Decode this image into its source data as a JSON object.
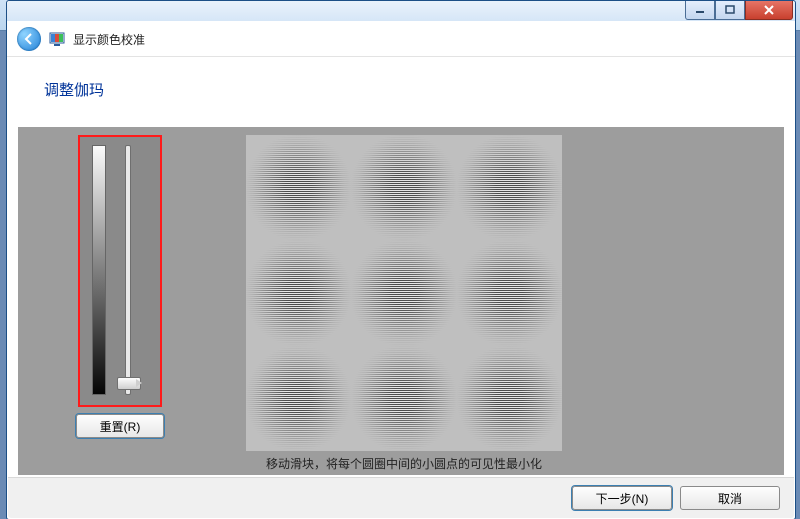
{
  "window": {
    "app_title": "显示颜色校准",
    "min_tip": "Minimize",
    "max_tip": "Maximize",
    "close_tip": "Close"
  },
  "page": {
    "heading": "调整伽玛",
    "reset_label": "重置(R)",
    "hint": "移动滑块，将每个圆圈中间的小圆点的可见性最小化"
  },
  "footer": {
    "next_label": "下一步(N)",
    "cancel_label": "取消"
  },
  "slider": {
    "min": 0,
    "max": 100,
    "value": 8
  }
}
